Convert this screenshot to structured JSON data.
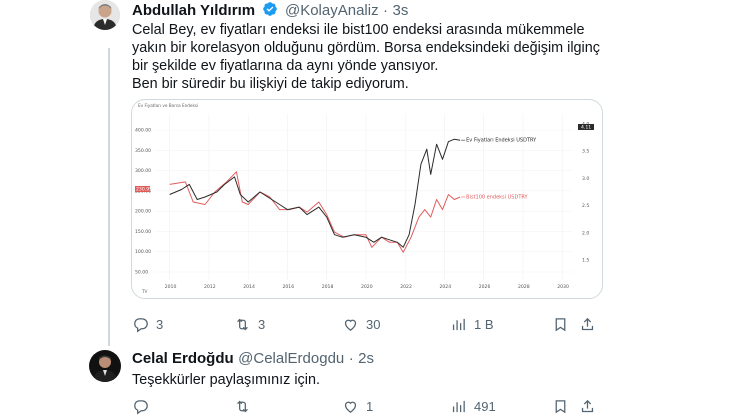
{
  "tweet1": {
    "name": "Abdullah Yıldırım",
    "handle": "@KolayAnaliz",
    "time": "3s",
    "text_lines": [
      "Celal Bey, ev fiyatları endeksi ile bist100 endeksi arasında mükemmele",
      "yakın bir korelasyon olduğunu gördüm.  Borsa endeksindeki değişim ilginç",
      "bir şekilde ev fiyatlarına da aynı yönde yansıyor.",
      "Ben bir süredir bu ilişkiyi de takip ediyorum."
    ],
    "actions": {
      "replies": "3",
      "retweets": "3",
      "likes": "30",
      "views": "1 B"
    }
  },
  "tweet2": {
    "name": "Celal Erdoğdu",
    "handle": "@CelalErdogdu",
    "time": "2s",
    "text": "Teşekkürler paylaşımınız için.",
    "actions": {
      "replies": "",
      "retweets": "",
      "likes": "1",
      "views": "491"
    }
  },
  "colors": {
    "verified": "#1d9bf0",
    "text": "#0f1419",
    "muted": "#536471",
    "series_house": "#2b2b2b",
    "series_bist": "#e05c5c"
  },
  "chart_data": {
    "type": "line",
    "header": "Ev Fiyatları ve Borsa Endeksi",
    "x_ticks": [
      "2010",
      "2012",
      "2014",
      "2016",
      "2018",
      "2020",
      "2022",
      "2024",
      "2026",
      "2028",
      "2030"
    ],
    "left_ticks": [
      "400.00",
      "350.00",
      "300.00",
      "250.00",
      "200.00",
      "150.00",
      "100.00",
      "50.00"
    ],
    "right_ticks": [
      "4.0",
      "3.5",
      "3.0",
      "2.5",
      "2.0",
      "1.5"
    ],
    "left_marker": "230.95",
    "right_marker": "4.11",
    "series": [
      {
        "name": "Ev Fiyatları Endeksi USDTRY",
        "values": [
          {
            "x": 2010.0,
            "y": 3.0
          },
          {
            "x": 2010.6,
            "y": 3.1
          },
          {
            "x": 2011.0,
            "y": 3.2
          },
          {
            "x": 2011.4,
            "y": 2.9
          },
          {
            "x": 2011.8,
            "y": 2.95
          },
          {
            "x": 2012.4,
            "y": 3.05
          },
          {
            "x": 2012.8,
            "y": 3.2
          },
          {
            "x": 2013.3,
            "y": 3.35
          },
          {
            "x": 2013.6,
            "y": 3.0
          },
          {
            "x": 2014.0,
            "y": 2.85
          },
          {
            "x": 2014.6,
            "y": 3.05
          },
          {
            "x": 2015.0,
            "y": 2.95
          },
          {
            "x": 2015.6,
            "y": 2.8
          },
          {
            "x": 2016.0,
            "y": 2.7
          },
          {
            "x": 2016.6,
            "y": 2.75
          },
          {
            "x": 2017.0,
            "y": 2.6
          },
          {
            "x": 2017.6,
            "y": 2.75
          },
          {
            "x": 2018.0,
            "y": 2.55
          },
          {
            "x": 2018.4,
            "y": 2.2
          },
          {
            "x": 2018.8,
            "y": 2.15
          },
          {
            "x": 2019.4,
            "y": 2.2
          },
          {
            "x": 2020.0,
            "y": 2.15
          },
          {
            "x": 2020.4,
            "y": 2.05
          },
          {
            "x": 2020.8,
            "y": 2.15
          },
          {
            "x": 2021.2,
            "y": 2.1
          },
          {
            "x": 2021.6,
            "y": 2.05
          },
          {
            "x": 2021.9,
            "y": 1.95
          },
          {
            "x": 2022.2,
            "y": 2.2
          },
          {
            "x": 2022.5,
            "y": 2.8
          },
          {
            "x": 2022.8,
            "y": 3.6
          },
          {
            "x": 2023.1,
            "y": 3.9
          },
          {
            "x": 2023.3,
            "y": 3.4
          },
          {
            "x": 2023.6,
            "y": 4.0
          },
          {
            "x": 2023.9,
            "y": 3.7
          },
          {
            "x": 2024.2,
            "y": 4.05
          },
          {
            "x": 2024.5,
            "y": 4.1
          },
          {
            "x": 2024.8,
            "y": 4.08
          }
        ]
      },
      {
        "name": "Bist100 endeksi USDTRY",
        "values": [
          {
            "x": 2010.0,
            "y": 3.2
          },
          {
            "x": 2010.8,
            "y": 3.25
          },
          {
            "x": 2011.2,
            "y": 2.85
          },
          {
            "x": 2011.8,
            "y": 2.8
          },
          {
            "x": 2012.3,
            "y": 3.05
          },
          {
            "x": 2012.9,
            "y": 3.25
          },
          {
            "x": 2013.4,
            "y": 3.45
          },
          {
            "x": 2013.7,
            "y": 2.85
          },
          {
            "x": 2014.0,
            "y": 2.8
          },
          {
            "x": 2014.6,
            "y": 3.05
          },
          {
            "x": 2015.1,
            "y": 2.95
          },
          {
            "x": 2015.6,
            "y": 2.7
          },
          {
            "x": 2016.1,
            "y": 2.7
          },
          {
            "x": 2016.6,
            "y": 2.75
          },
          {
            "x": 2017.0,
            "y": 2.65
          },
          {
            "x": 2017.6,
            "y": 2.85
          },
          {
            "x": 2018.0,
            "y": 2.6
          },
          {
            "x": 2018.4,
            "y": 2.25
          },
          {
            "x": 2018.9,
            "y": 2.15
          },
          {
            "x": 2019.4,
            "y": 2.2
          },
          {
            "x": 2020.0,
            "y": 2.2
          },
          {
            "x": 2020.3,
            "y": 1.95
          },
          {
            "x": 2020.8,
            "y": 2.15
          },
          {
            "x": 2021.2,
            "y": 2.05
          },
          {
            "x": 2021.6,
            "y": 2.05
          },
          {
            "x": 2021.9,
            "y": 1.85
          },
          {
            "x": 2022.3,
            "y": 2.15
          },
          {
            "x": 2022.7,
            "y": 2.55
          },
          {
            "x": 2023.0,
            "y": 2.7
          },
          {
            "x": 2023.3,
            "y": 2.55
          },
          {
            "x": 2023.6,
            "y": 2.9
          },
          {
            "x": 2023.9,
            "y": 2.7
          },
          {
            "x": 2024.2,
            "y": 3.0
          },
          {
            "x": 2024.5,
            "y": 2.9
          },
          {
            "x": 2024.8,
            "y": 2.95
          }
        ]
      }
    ],
    "xlim": [
      2009.2,
      2030.5
    ],
    "ylim": [
      1.3,
      4.6
    ],
    "grid": true
  }
}
